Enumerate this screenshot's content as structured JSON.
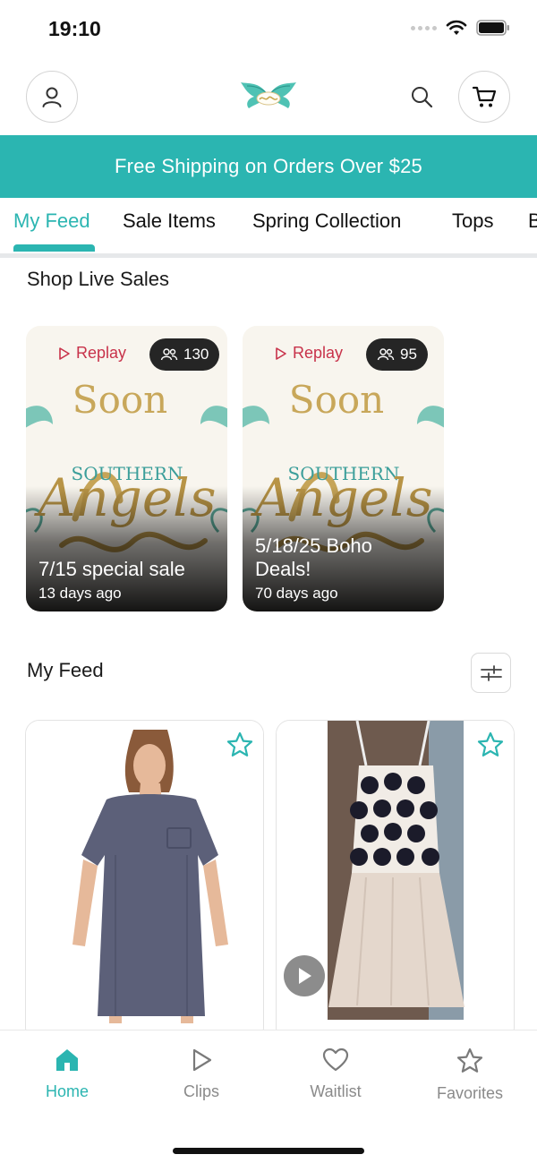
{
  "status_bar": {
    "time": "19:10"
  },
  "header": {
    "logo_alt": "Southern Angels"
  },
  "banner": {
    "text": "Free Shipping on Orders Over $25"
  },
  "tabs": [
    {
      "label": "My Feed",
      "active": true
    },
    {
      "label": "Sale Items",
      "active": false
    },
    {
      "label": "Spring Collection",
      "active": false
    },
    {
      "label": "Tops",
      "active": false
    },
    {
      "label": "B",
      "active": false
    }
  ],
  "live_sales": {
    "title": "Shop Live Sales",
    "cards": [
      {
        "replay_label": "Replay",
        "viewers": "130",
        "title": "7/15 special sale",
        "time_ago": "13 days ago"
      },
      {
        "replay_label": "Replay",
        "viewers": "95",
        "title": "5/18/25 Boho Deals!",
        "time_ago": "70 days ago"
      }
    ]
  },
  "art": {
    "top_text": "Soon",
    "brand_small": "SOUTHERN",
    "brand_script": "Angels"
  },
  "feed": {
    "title": "My Feed"
  },
  "colors": {
    "accent": "#2bb5b1",
    "replay": "#c8324a"
  },
  "nav": [
    {
      "label": "Home",
      "icon": "home-icon",
      "active": true
    },
    {
      "label": "Clips",
      "icon": "play-icon",
      "active": false
    },
    {
      "label": "Waitlist",
      "icon": "heart-icon",
      "active": false
    },
    {
      "label": "Favorites",
      "icon": "star-icon",
      "active": false
    }
  ]
}
